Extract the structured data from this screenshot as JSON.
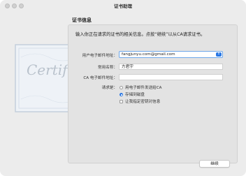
{
  "window": {
    "title": "证书助理"
  },
  "section": {
    "title": "证书信息"
  },
  "intro": "输入你正在请求的证书的相关信息。点按“继续”以从CA请求证书。",
  "form": {
    "email_label": "用户电子邮件地址：",
    "email_value": "fangjunyu.com@gmail.com",
    "name_label": "常用名称：",
    "name_value": "方君宇",
    "ca_email_label": "CA 电子邮件地址：",
    "ca_email_value": "",
    "request_label": "请求是：",
    "options": [
      {
        "label": "用电子邮件发送给CA",
        "selected": false
      },
      {
        "label": "存储到磁盘",
        "selected": true
      }
    ],
    "checkbox_label": "让我指定密钥对信息",
    "checkbox_checked": false
  },
  "buttons": {
    "continue": "继续"
  },
  "decor": {
    "cert_script": "Certif"
  }
}
